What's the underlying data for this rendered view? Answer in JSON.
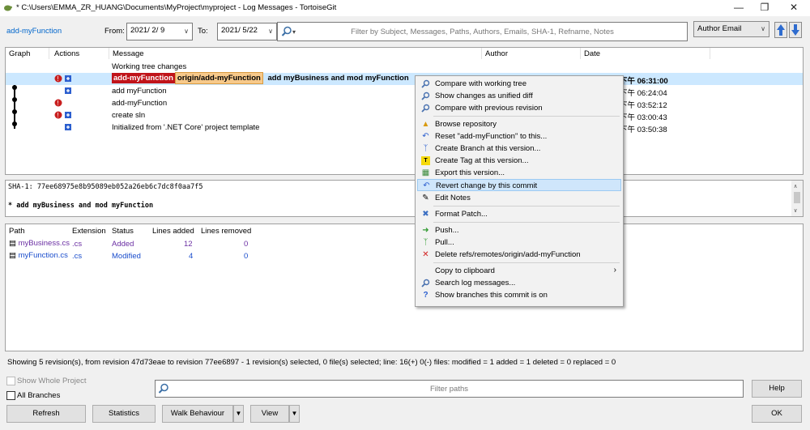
{
  "window": {
    "title": "* C:\\Users\\EMMA_ZR_HUANG\\Documents\\MyProject\\myproject - Log Messages - TortoiseGit",
    "minimize": "—",
    "restore": "❐",
    "close": "✕"
  },
  "filter": {
    "branch_link": "add-myFunction",
    "from_label": "From:",
    "from_date": "2021/ 2/ 9",
    "to_label": "To:",
    "to_date": "2021/ 5/22",
    "search_placeholder": "Filter by Subject, Messages, Paths, Authors, Emails, SHA-1, Refname, Notes",
    "author_field": "Author Email"
  },
  "log": {
    "columns": {
      "graph": "Graph",
      "actions": "Actions",
      "message": "Message",
      "author": "Author",
      "date": "Date"
    },
    "rows": [
      {
        "message": "Working tree changes",
        "date": ""
      },
      {
        "branch_tag": "add-myFunction",
        "remote_tag": "origin/add-myFunction",
        "message": "add myBusiness and mod myFunction",
        "date": "下午 06:31:00"
      },
      {
        "message": "add myFunction",
        "date": "下午 06:24:04"
      },
      {
        "message": "add-myFunction",
        "date": "下午 03:52:12"
      },
      {
        "message": "create sln",
        "date": "下午 03:00:43"
      },
      {
        "message": "Initialized from '.NET Core' project template",
        "date": "下午 03:50:38"
      }
    ]
  },
  "commit": {
    "sha": "SHA-1: 77ee68975e8b95089eb052a26eb6c7dc8f0aa7f5",
    "message": "* add myBusiness and mod myFunction"
  },
  "files": {
    "columns": {
      "path": "Path",
      "extension": "Extension",
      "status": "Status",
      "added": "Lines added",
      "removed": "Lines removed"
    },
    "rows": [
      {
        "path": "myBusiness.cs",
        "ext": ".cs",
        "status": "Added",
        "added": "12",
        "removed": "0"
      },
      {
        "path": "myFunction.cs",
        "ext": ".cs",
        "status": "Modified",
        "added": "4",
        "removed": "0"
      }
    ]
  },
  "status_line": "Showing 5 revision(s), from revision 47d73eae to revision 77ee6897 - 1 revision(s) selected, 0 file(s) selected; line: 16(+) 0(-) files: modified = 1 added = 1 deleted = 0 replaced = 0",
  "bottom": {
    "show_whole_project": "Show Whole Project",
    "all_branches": "All Branches",
    "filter_paths_placeholder": "Filter paths",
    "refresh": "Refresh",
    "statistics": "Statistics",
    "walk_behaviour": "Walk Behaviour",
    "view": "View",
    "help": "Help",
    "ok": "OK"
  },
  "context_menu": {
    "items": [
      "Compare with working tree",
      "Show changes as unified diff",
      "Compare with previous revision",
      "Browse repository",
      "Reset \"add-myFunction\" to this...",
      "Create Branch at this version...",
      "Create Tag at this version...",
      "Export this version...",
      "Revert change by this commit",
      "Edit Notes",
      "Format Patch...",
      "Push...",
      "Pull...",
      "Delete refs/remotes/origin/add-myFunction",
      "Copy to clipboard",
      "Search log messages...",
      "Show branches this commit is on"
    ],
    "submenu_arrow": "›"
  },
  "colors": {
    "selection": "#cce8ff",
    "menu_highlight": "#cfe6fb",
    "branch_tag": "#c0141a",
    "remote_tag": "#f7c98a",
    "link": "#0066cc"
  }
}
